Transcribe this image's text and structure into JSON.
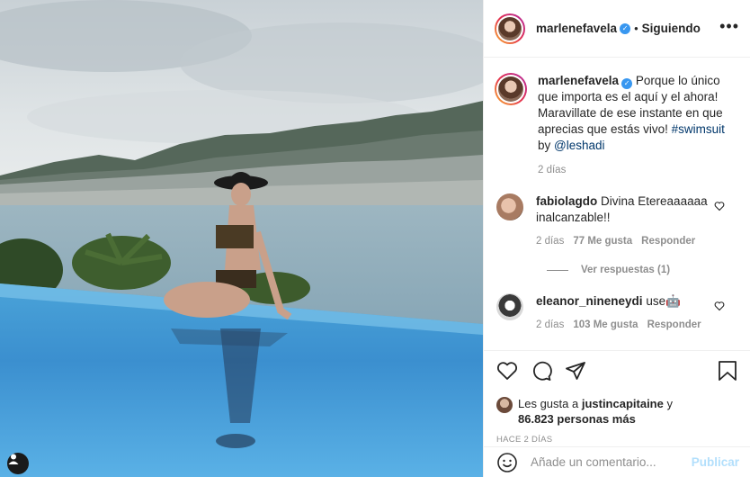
{
  "post": {
    "author": "marlenefavela",
    "follow_status": "Siguiendo",
    "caption": {
      "text_before": "Porque lo único que importa es el aquí y el ahora! Maravillate de ese instante en que aprecias que estás vivo! ",
      "hashtag": "#swimsuit",
      "by_word": " by ",
      "mention": "@leshadi",
      "time": "2 días"
    },
    "comments": [
      {
        "user": "fabiolagdo",
        "text": "Divina Etereaaaaaa inalcanzable!!",
        "time": "2 días",
        "likes": "77 Me gusta",
        "reply_label": "Responder",
        "view_replies": "Ver respuestas (1)"
      },
      {
        "user": "eleanor_nineneydi",
        "text": "use🤖",
        "time": "2 días",
        "likes": "103 Me gusta",
        "reply_label": "Responder"
      }
    ],
    "likes": {
      "prefix": "Les gusta a ",
      "user": "justincapitaine",
      "suffix": " y",
      "count": "86.823 personas más"
    },
    "date": "HACE 2 DÍAS",
    "add_comment": {
      "placeholder": "Añade un comentario...",
      "publish": "Publicar"
    },
    "colors": {
      "accent": "#3897f0",
      "publish_disabled": "#b2dffc",
      "muted": "#8e8e8e"
    }
  }
}
